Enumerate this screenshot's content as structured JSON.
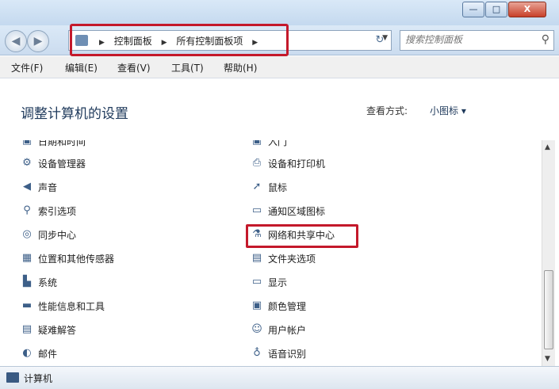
{
  "window": {
    "minimize_label": "—",
    "maximize_label": "□",
    "close_label": "X"
  },
  "nav": {
    "back_glyph": "◀",
    "forward_glyph": "▶",
    "breadcrumbs": [
      "控制面板",
      "所有控制面板项"
    ],
    "crumb_sep": "▶",
    "dropdown_glyph": "▼",
    "refresh_glyph": "↻",
    "search_placeholder": "搜索控制面板",
    "search_icon_glyph": "⚲"
  },
  "menubar": {
    "items": [
      "文件(F)",
      "编辑(E)",
      "查看(V)",
      "工具(T)",
      "帮助(H)"
    ]
  },
  "header": {
    "title": "调整计算机的设置",
    "view_by_label": "查看方式:",
    "view_by_value": "小图标 ▾"
  },
  "items": {
    "left": [
      {
        "label": "日期和时间",
        "icon": "clock-icon",
        "glyph": "▣"
      },
      {
        "label": "设备管理器",
        "icon": "device-manager-icon",
        "glyph": "⚙"
      },
      {
        "label": "声音",
        "icon": "speaker-icon",
        "glyph": "◀"
      },
      {
        "label": "索引选项",
        "icon": "magnifier-icon",
        "glyph": "⚲"
      },
      {
        "label": "同步中心",
        "icon": "sync-icon",
        "glyph": "◎"
      },
      {
        "label": "位置和其他传感器",
        "icon": "sensor-icon",
        "glyph": "▦"
      },
      {
        "label": "系统",
        "icon": "system-icon",
        "glyph": "▙"
      },
      {
        "label": "性能信息和工具",
        "icon": "performance-icon",
        "glyph": "▬"
      },
      {
        "label": "疑难解答",
        "icon": "troubleshoot-icon",
        "glyph": "▤"
      },
      {
        "label": "邮件",
        "icon": "mail-icon",
        "glyph": "◐"
      }
    ],
    "right": [
      {
        "label": "入门",
        "icon": "getting-started-icon",
        "glyph": "▣"
      },
      {
        "label": "设备和打印机",
        "icon": "printer-icon",
        "glyph": "⎙"
      },
      {
        "label": "鼠标",
        "icon": "mouse-icon",
        "glyph": "➚"
      },
      {
        "label": "通知区域图标",
        "icon": "notification-icon",
        "glyph": "▭"
      },
      {
        "label": "网络和共享中心",
        "icon": "network-icon",
        "glyph": "⚗"
      },
      {
        "label": "文件夹选项",
        "icon": "folder-icon",
        "glyph": "▤"
      },
      {
        "label": "显示",
        "icon": "display-icon",
        "glyph": "▭"
      },
      {
        "label": "颜色管理",
        "icon": "color-management-icon",
        "glyph": "▣"
      },
      {
        "label": "用户帐户",
        "icon": "user-accounts-icon",
        "glyph": "☺"
      },
      {
        "label": "语音识别",
        "icon": "microphone-icon",
        "glyph": "♁"
      }
    ]
  },
  "scrollbar": {
    "up_glyph": "▲",
    "down_glyph": "▼"
  },
  "status": {
    "text": "计算机"
  },
  "colors": {
    "highlight": "#c4192b",
    "title": "#1e395b"
  }
}
